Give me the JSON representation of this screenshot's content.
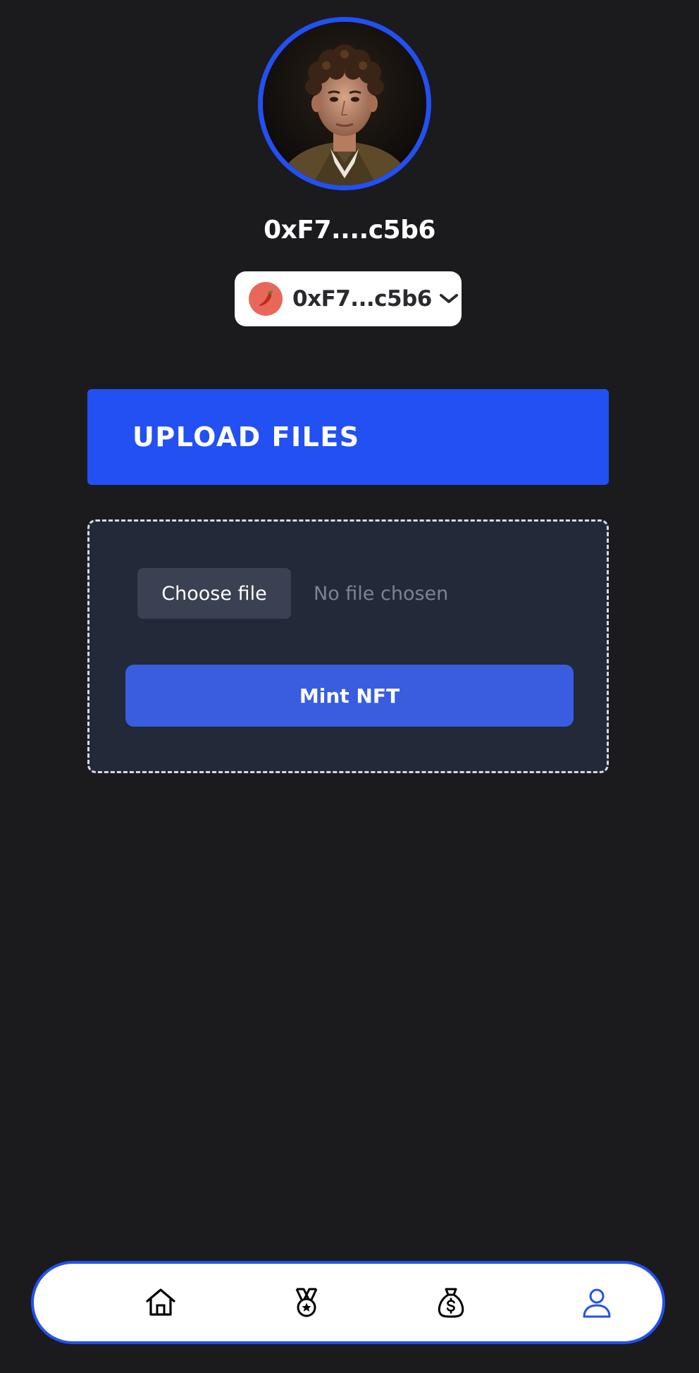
{
  "profile": {
    "address_title": "0xF7....c5b6"
  },
  "wallet": {
    "label": "0xF7...c5b6",
    "network_icon": "chili-pepper-icon",
    "chevron_icon": "chevron-down-icon"
  },
  "upload": {
    "banner_title": "UPLOAD FILES",
    "choose_file_label": "Choose file",
    "no_file_text": "No file chosen",
    "mint_label": "Mint NFT"
  },
  "nav": {
    "items": [
      {
        "icon": "home-icon",
        "active": false
      },
      {
        "icon": "medal-icon",
        "active": false
      },
      {
        "icon": "money-bag-icon",
        "active": false
      },
      {
        "icon": "user-icon",
        "active": true
      }
    ]
  },
  "colors": {
    "background": "#1b1a1d",
    "accent": "#2350f2",
    "mint_button": "#3a5de0",
    "panel": "#222938",
    "nav_active": "#2350f2",
    "nav_inactive": "#000000"
  }
}
